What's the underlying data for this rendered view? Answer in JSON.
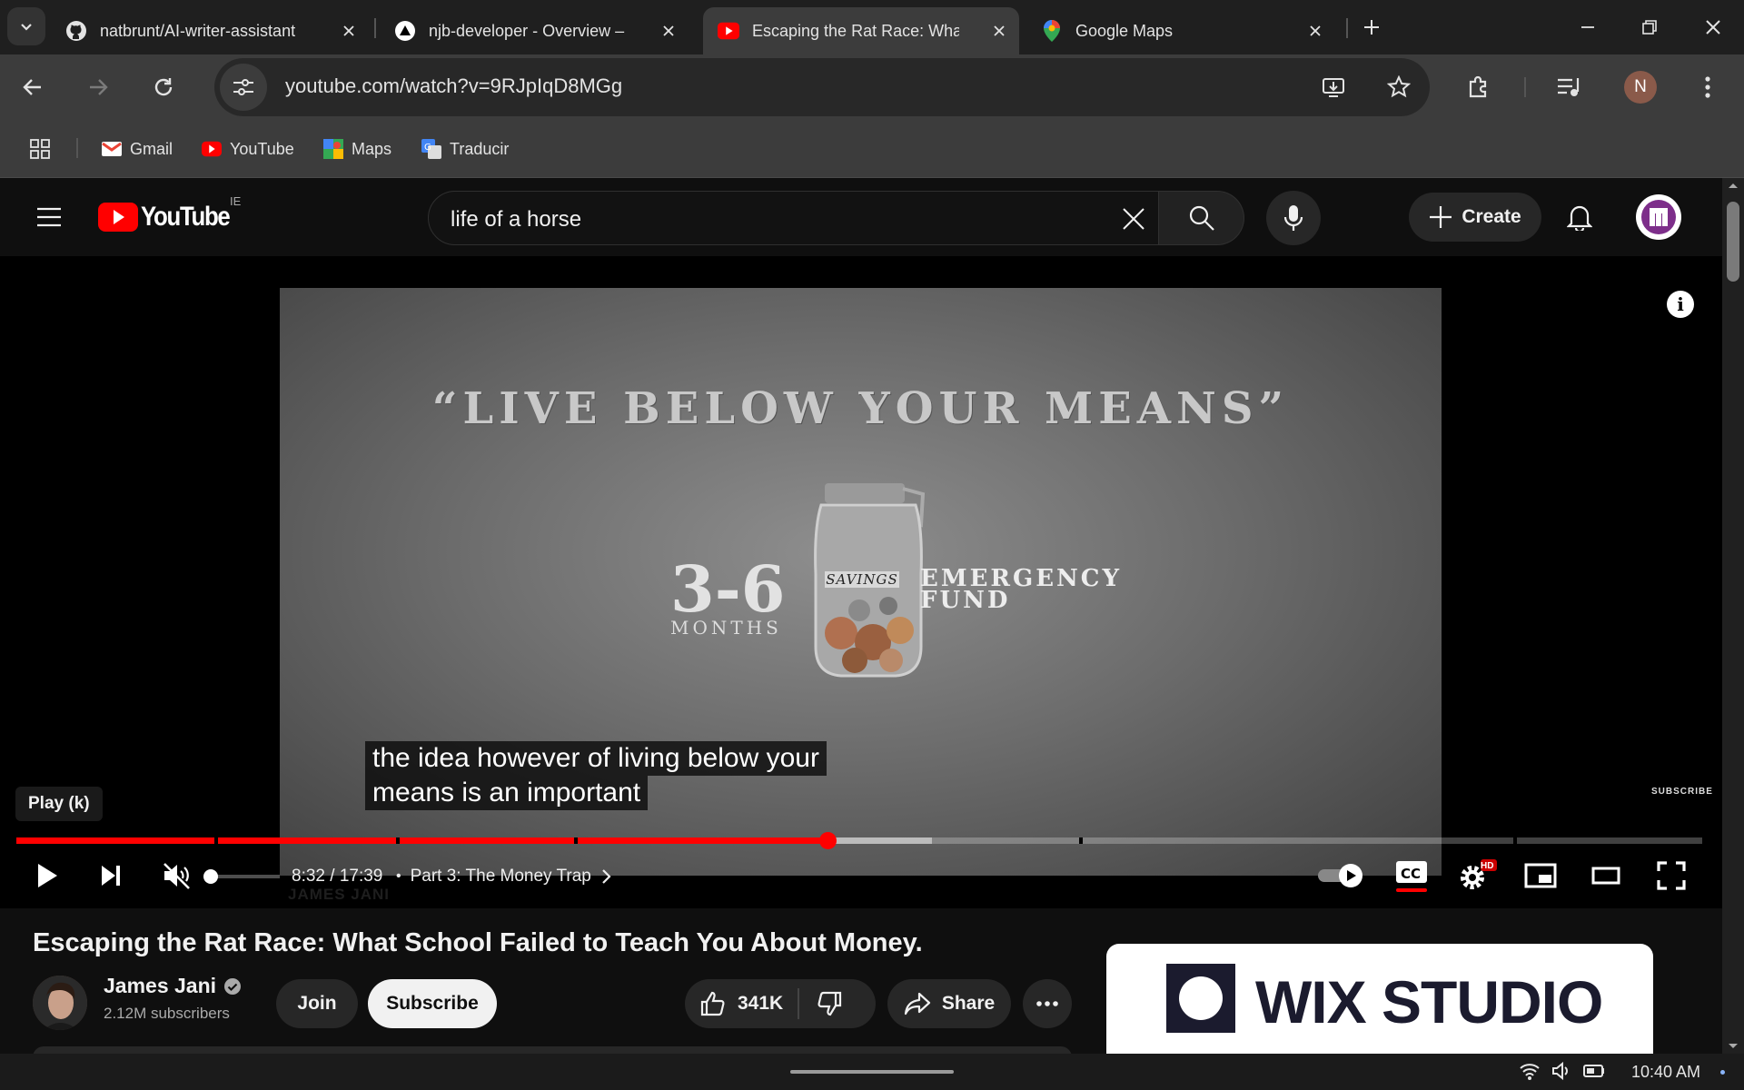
{
  "tabs": [
    {
      "title": "natbrunt/AI-writer-assistant",
      "icon": "github-icon"
    },
    {
      "title": "njb-developer - Overview – V",
      "icon": "vercel-icon"
    },
    {
      "title": "Escaping the Rat Race: What",
      "icon": "youtube-icon",
      "active": true
    },
    {
      "title": "Google Maps",
      "icon": "maps-pin-icon"
    }
  ],
  "toolbar": {
    "url": "youtube.com/watch?v=9RJpIqD8MGg",
    "profile_initial": "N"
  },
  "bookmarks": [
    {
      "label": "Gmail",
      "icon": "gmail-icon"
    },
    {
      "label": "YouTube",
      "icon": "youtube-icon"
    },
    {
      "label": "Maps",
      "icon": "maps-icon"
    },
    {
      "label": "Traducir",
      "icon": "translate-icon"
    }
  ],
  "youtube": {
    "logo_text": "YouTube",
    "region": "IE",
    "search_value": "life of a horse",
    "create_label": "Create"
  },
  "player": {
    "video_text": {
      "quote": "“LIVE BELOW YOUR MEANS”",
      "months_num": "3-6",
      "months": "MONTHS",
      "jar_label": "SAVINGS",
      "emergency_line1": "EMERGENCY",
      "emergency_line2": "FUND",
      "subscribe_mark": "SUBSCRIBE",
      "watermark": "JAMES JANI"
    },
    "captions": [
      "the idea however of living below your",
      "means is an important"
    ],
    "tooltip": "Play (k)",
    "current_time": "8:32",
    "duration": "17:39",
    "time_display": "8:32 / 17:39",
    "chapter": "Part 3: The Money Trap",
    "progress_played": 0.481,
    "progress_buffered": 0.543,
    "volume_level": 0,
    "hd_badge": "HD"
  },
  "video": {
    "title": "Escaping the Rat Race: What School Failed to Teach You About Money.",
    "channel": "James Jani",
    "subscribers": "2.12M subscribers",
    "join_label": "Join",
    "subscribe_label": "Subscribe",
    "likes": "341K",
    "share_label": "Share"
  },
  "ad": {
    "text": "WIX STUDIO"
  },
  "system": {
    "time": "10:40 AM"
  },
  "colors": {
    "accent": "#ff0000",
    "background": "#0f0f0f",
    "chrome": "#3c3c3c"
  }
}
